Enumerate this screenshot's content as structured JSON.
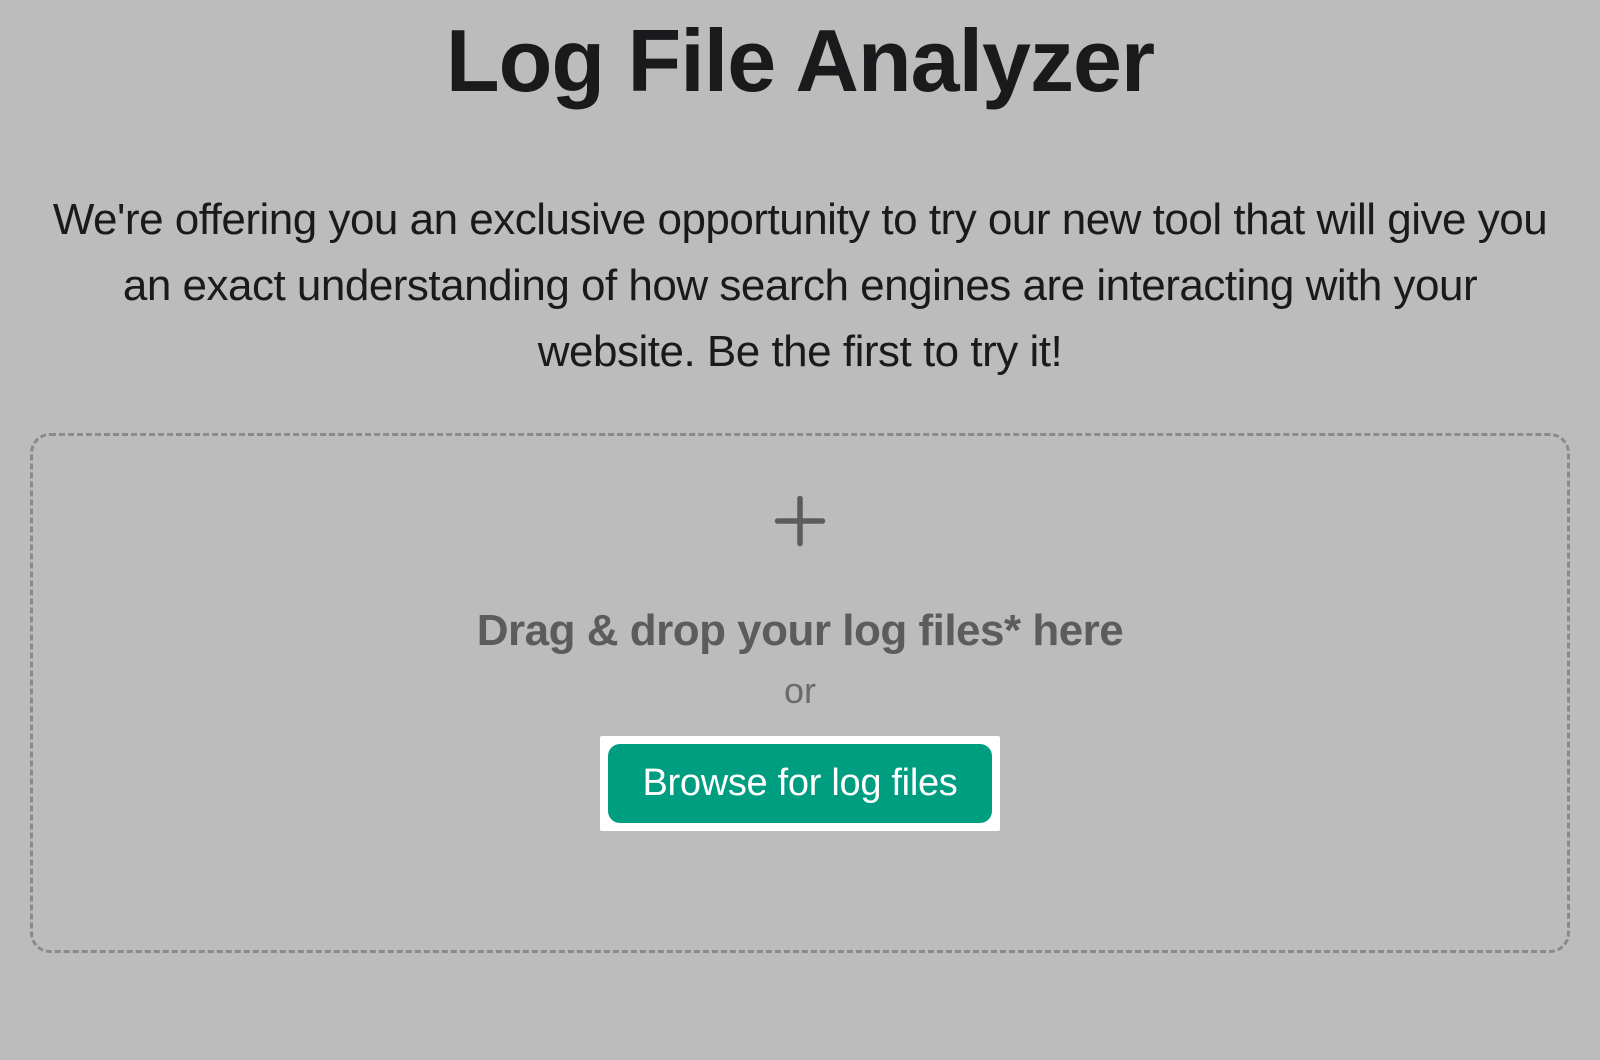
{
  "header": {
    "title": "Log File Analyzer",
    "description": "We're offering you an exclusive opportunity to try our new tool that will give you an exact understanding of how search engines are interacting with your website. Be the first to try it!"
  },
  "dropzone": {
    "drag_text": "Drag & drop your log files* here",
    "or_text": "or",
    "browse_button_label": "Browse for log files"
  },
  "colors": {
    "background": "#bcbcbc",
    "primary_button": "#009e81",
    "border_dashed": "#8a8a8a",
    "text_dark": "#1a1a1d",
    "text_muted": "#5c5c5c"
  }
}
